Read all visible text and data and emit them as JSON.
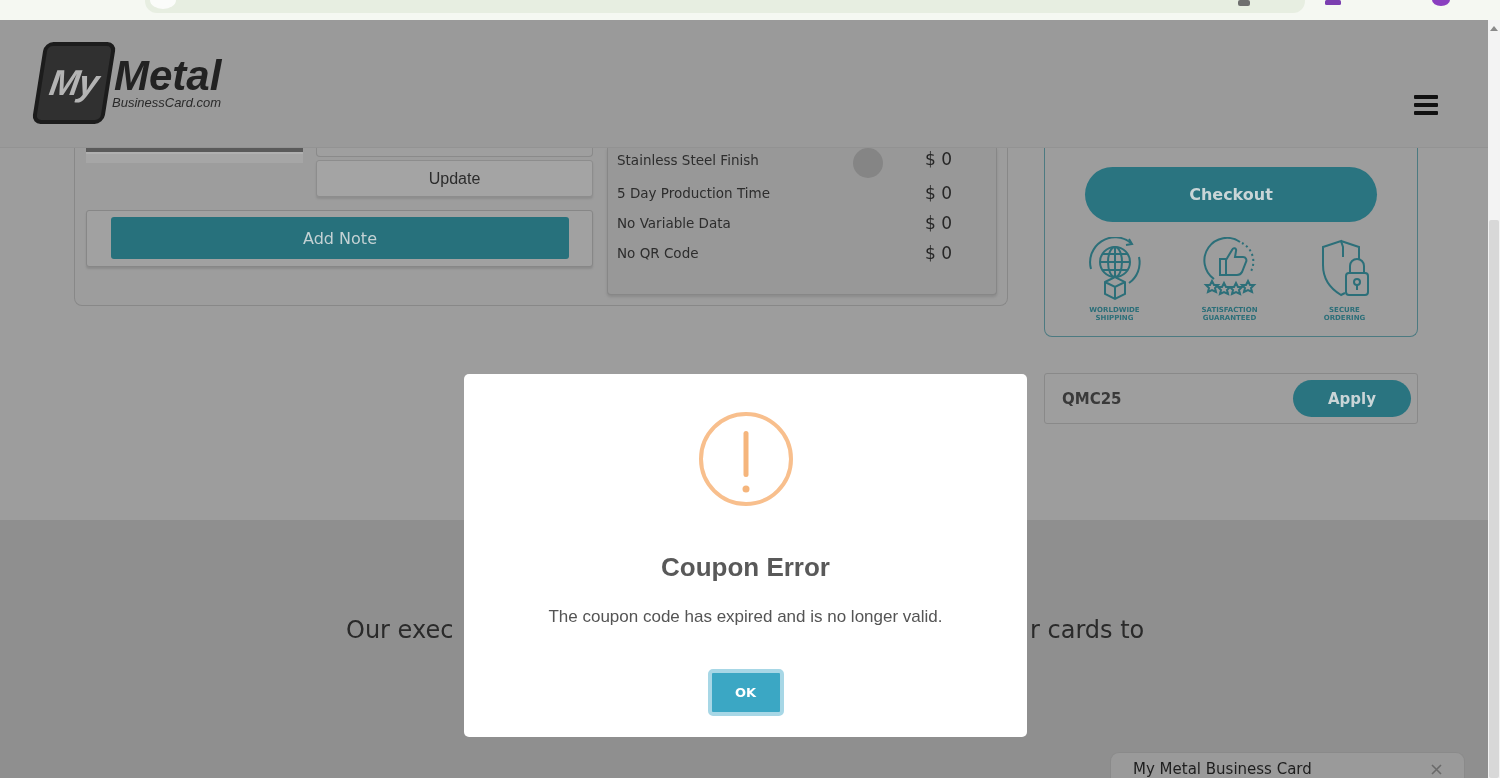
{
  "header": {
    "logo": {
      "mark": "My",
      "name": "Metal",
      "domain": "BusinessCard.com"
    }
  },
  "cart_item": {
    "update_button": "Update",
    "add_note_button": "Add Note",
    "options": [
      {
        "kind": "finish",
        "label": "Stainless Steel Finish",
        "price": "$ 0"
      },
      {
        "kind": "option",
        "label": "5 Day Production Time",
        "price": "$ 0"
      },
      {
        "kind": "option",
        "label": "No Variable Data",
        "price": "$ 0"
      },
      {
        "kind": "option",
        "label": "No QR Code",
        "price": "$ 0"
      }
    ]
  },
  "checkout": {
    "button": "Checkout",
    "badges": [
      {
        "kind": "shipping",
        "label": "WORLDWIDE SHIPPING"
      },
      {
        "kind": "satisfaction",
        "label": "SATISFACTION GUARANTEED"
      },
      {
        "kind": "security",
        "label": "SECURE ORDERING"
      }
    ]
  },
  "coupon": {
    "value": "QMC25",
    "button": "Apply"
  },
  "section": {
    "text_fragments": [
      "Our exec",
      "r cards to"
    ]
  },
  "chat_widget": {
    "title": "My Metal Business Card"
  },
  "dialog": {
    "title": "Coupon Error",
    "message": "The coupon code has expired and is no longer valid.",
    "button": "OK"
  }
}
